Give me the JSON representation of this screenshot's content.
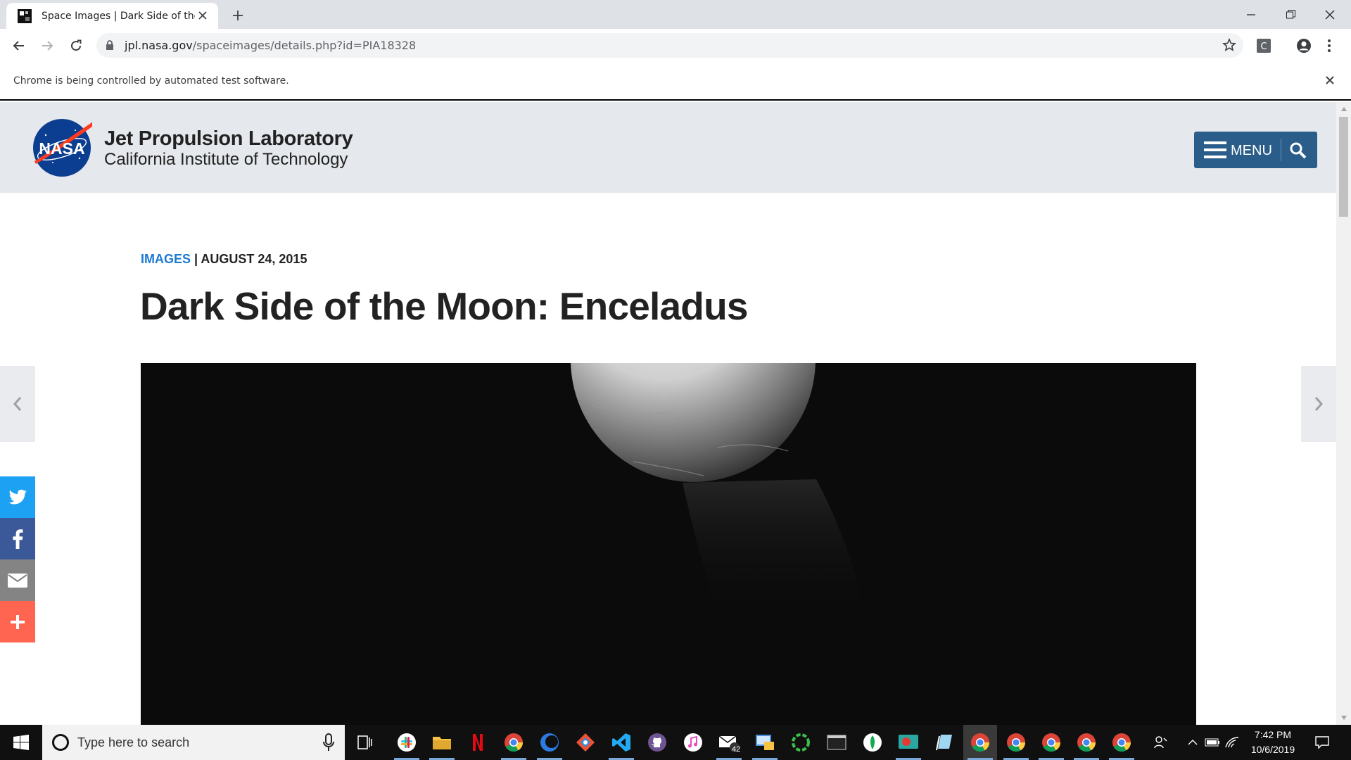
{
  "browser": {
    "tab_title": "Space Images | Dark Side of the Moon: Enceladus",
    "url_host": "jpl.nasa.gov",
    "url_path": "/spaceimages/details.php?id=PIA18328",
    "infobar_text": "Chrome is being controlled by automated test software."
  },
  "site": {
    "logo_text": "NASA",
    "org_name": "Jet Propulsion Laboratory",
    "org_sub": "California Institute of Technology",
    "menu_label": "MENU"
  },
  "article": {
    "category": "IMAGES",
    "separator": " | ",
    "date": "AUGUST 24, 2015",
    "title": "Dark Side of the Moon: Enceladus"
  },
  "share": {
    "items": [
      {
        "name": "twitter",
        "color": "#1da1f2"
      },
      {
        "name": "facebook",
        "color": "#3b5998"
      },
      {
        "name": "email",
        "color": "#848484"
      },
      {
        "name": "more",
        "color": "#ff6550"
      }
    ]
  },
  "taskbar": {
    "search_placeholder": "Type here to search",
    "mail_badge": "42",
    "time": "7:42 PM",
    "date": "10/6/2019"
  },
  "colors": {
    "accent_link": "#1a7ad4",
    "menu_button": "#2a5d8a",
    "header_bg": "#e5e8ec"
  }
}
